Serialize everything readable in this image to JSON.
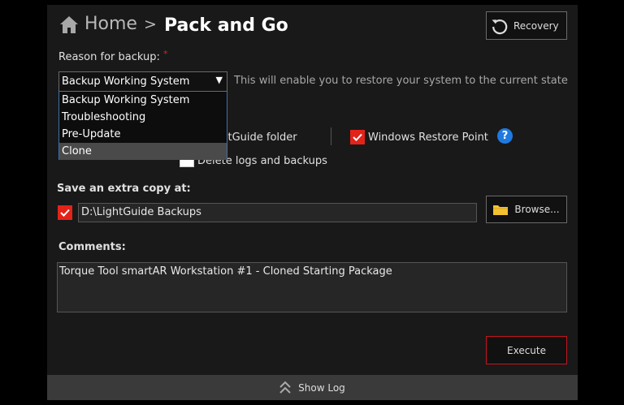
{
  "header": {
    "home_label": "Home",
    "separator": ">",
    "title": "Pack and Go",
    "recovery_label": "Recovery"
  },
  "reason": {
    "label": "Reason for backup:",
    "required_mark": "*",
    "selected": "Backup Working System",
    "options": [
      "Backup Working System",
      "Troubleshooting",
      "Pre-Update",
      "Clone"
    ],
    "highlighted_option": "Clone",
    "hint": "This will enable you to restore your system to the current state"
  },
  "options": {
    "lightguide_folder_label": "ghtGuide folder",
    "restore_point_label": "Windows Restore Point",
    "restore_point_checked": true,
    "delete_logs_label": "Delete logs and backups",
    "delete_logs_checked": false
  },
  "extra_copy": {
    "label": "Save an extra copy at:",
    "checked": true,
    "path": "D:\\LightGuide Backups",
    "browse_label": "Browse..."
  },
  "comments": {
    "label": "Comments:",
    "value": "Torque Tool smartAR Workstation #1 - Cloned Starting Package"
  },
  "actions": {
    "execute_label": "Execute"
  },
  "footer": {
    "show_log_label": "Show Log"
  },
  "colors": {
    "accent_red": "#e2231a",
    "help_blue": "#1f7ae0",
    "folder_yellow": "#f2c230"
  }
}
